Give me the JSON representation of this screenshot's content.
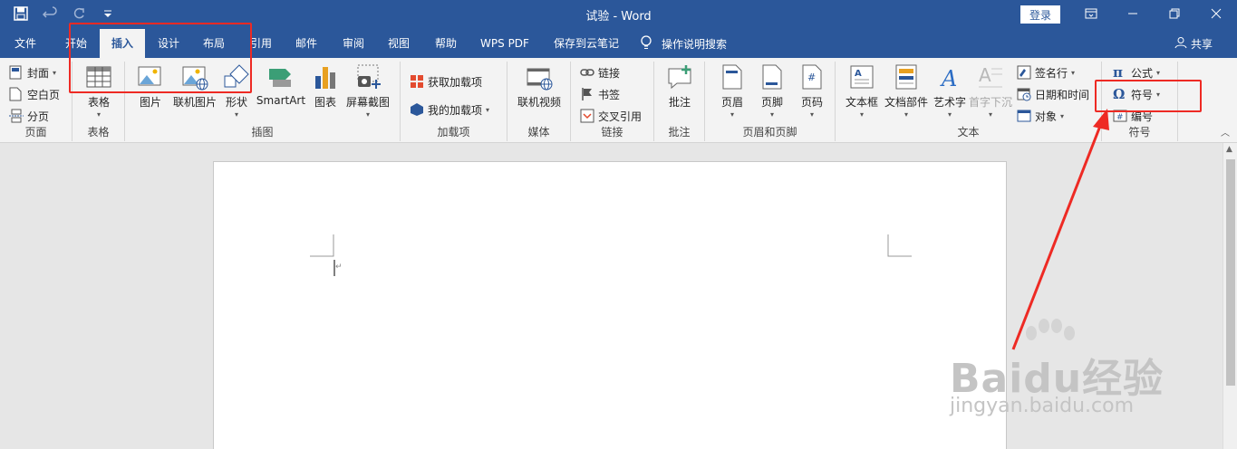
{
  "window": {
    "title": "试验  -  Word",
    "login": "登录"
  },
  "tabs": [
    "文件",
    "开始",
    "插入",
    "设计",
    "布局",
    "引用",
    "邮件",
    "审阅",
    "视图",
    "帮助",
    "WPS PDF",
    "保存到云笔记"
  ],
  "active_tab": "插入",
  "search_placeholder": "操作说明搜索",
  "share": "共享",
  "ribbon": {
    "pages": {
      "label": "页面",
      "cover": "封面",
      "blank": "空白页",
      "break": "分页"
    },
    "table": {
      "label": "表格",
      "btn": "表格"
    },
    "illustrations": {
      "label": "插图",
      "picture": "图片",
      "online_picture": "联机图片",
      "shapes": "形状",
      "smartart": "SmartArt",
      "chart": "图表",
      "screenshot": "屏幕截图"
    },
    "addins": {
      "label": "加载项",
      "get": "获取加载项",
      "my": "我的加载项"
    },
    "media": {
      "label": "媒体",
      "video": "联机视频"
    },
    "links": {
      "label": "链接",
      "link": "链接",
      "bookmark": "书签",
      "crossref": "交叉引用"
    },
    "comments": {
      "label": "批注",
      "btn": "批注"
    },
    "headerfooter": {
      "label": "页眉和页脚",
      "header": "页眉",
      "footer": "页脚",
      "pagenum": "页码"
    },
    "text": {
      "label": "文本",
      "textbox": "文本框",
      "quickparts": "文档部件",
      "wordart": "艺术字",
      "dropcap": "首字下沉",
      "signature": "签名行",
      "datetime": "日期和时间",
      "object": "对象"
    },
    "symbols": {
      "label": "符号",
      "equation": "公式",
      "symbol": "符号",
      "number": "编号"
    }
  },
  "watermark": {
    "brand": "Baidu经验",
    "url": "jingyan.baidu.com"
  },
  "colors": {
    "brand": "#2b579a",
    "ribbon": "#f3f3f3",
    "annotation": "#ee2a24"
  }
}
